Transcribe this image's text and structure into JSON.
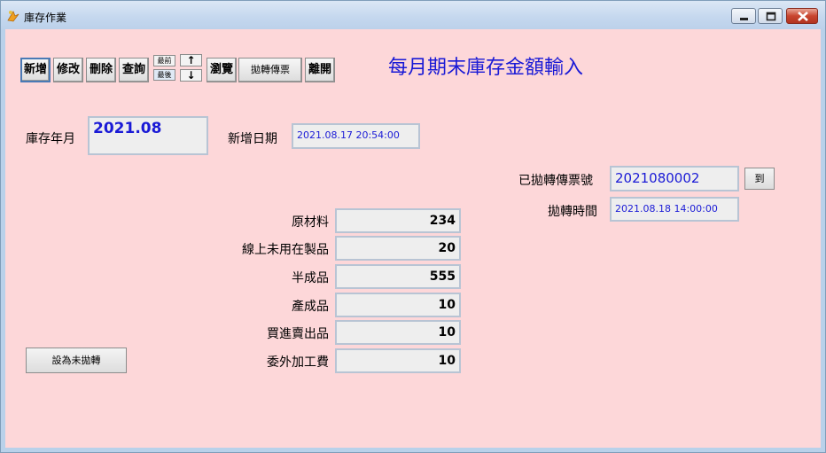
{
  "window": {
    "title": "庫存作業"
  },
  "toolbar": {
    "add": "新增",
    "edit": "修改",
    "delete": "刪除",
    "query": "查詢",
    "first": "最前",
    "last": "最後",
    "up_arrow": "↑",
    "down_arrow": "↓",
    "browse": "瀏覽",
    "post_voucher": "拋轉傳票",
    "exit": "離開"
  },
  "heading": "每月期末庫存金額輸入",
  "form": {
    "stock_month_label": "庫存年月",
    "stock_month_value": "2021.08",
    "create_date_label": "新增日期",
    "create_date_value": "2021.08.17 20:54:00",
    "voucher_no_label": "已拋轉傳票號",
    "voucher_no_value": "2021080002",
    "goto_button": "到",
    "post_time_label": "拋轉時間",
    "post_time_value": "2021.08.18 14:00:00",
    "items": [
      {
        "label": "原材料",
        "value": "234"
      },
      {
        "label": "線上未用在製品",
        "value": "20"
      },
      {
        "label": "半成品",
        "value": "555"
      },
      {
        "label": "產成品",
        "value": "10"
      },
      {
        "label": "買進賣出品",
        "value": "10"
      },
      {
        "label": "委外加工費",
        "value": "10"
      }
    ],
    "set_unposted_button": "設為未拋轉"
  }
}
